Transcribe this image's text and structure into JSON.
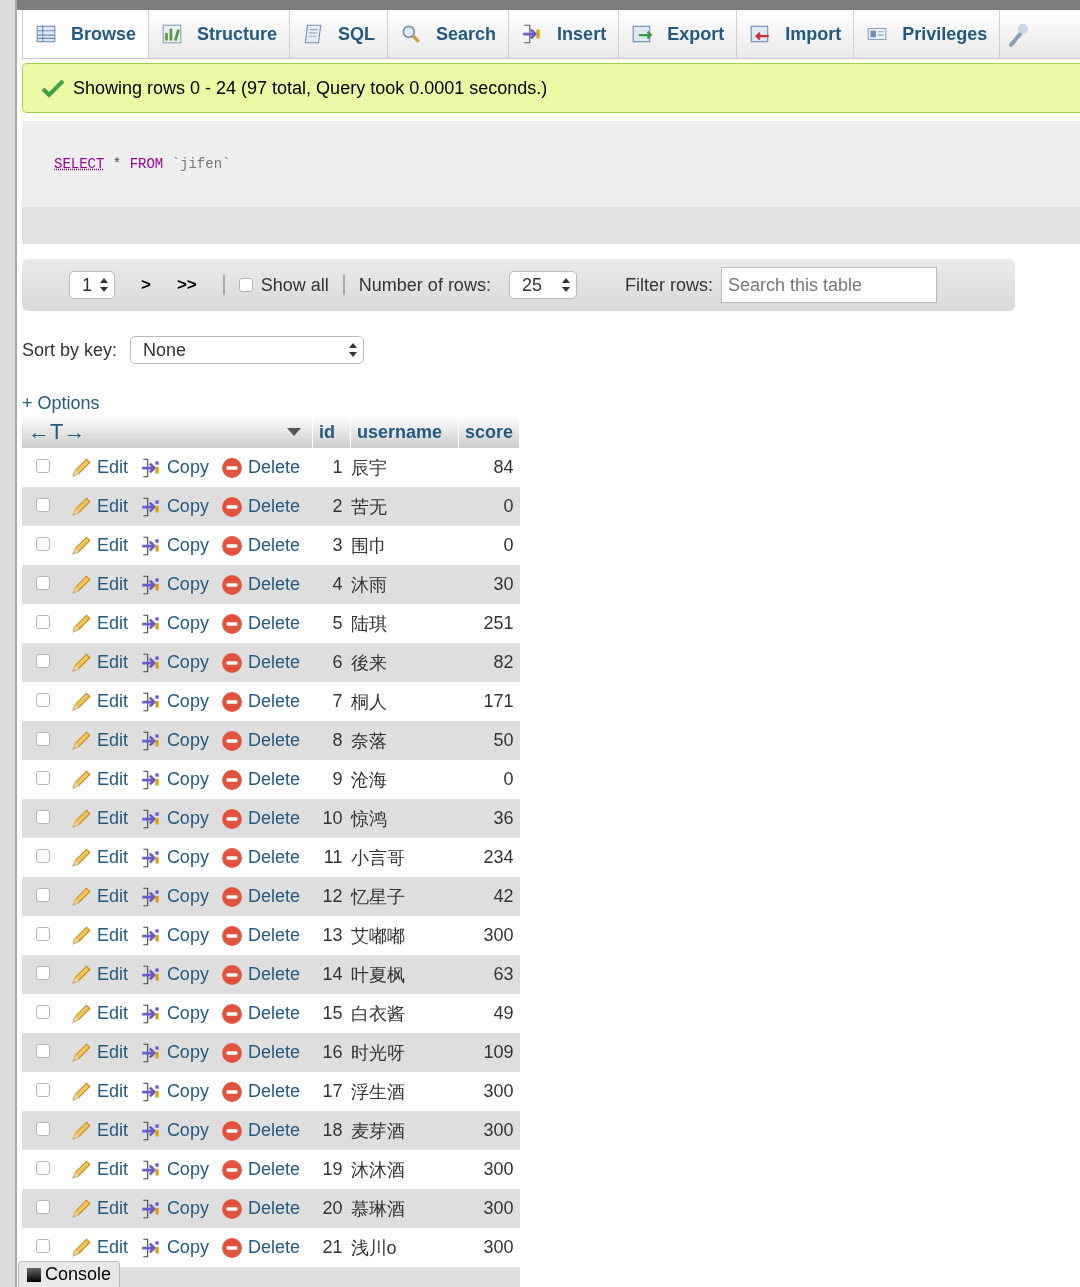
{
  "tabs": [
    {
      "label": "Browse",
      "selected": true
    },
    {
      "label": "Structure",
      "selected": false
    },
    {
      "label": "SQL",
      "selected": false
    },
    {
      "label": "Search",
      "selected": false
    },
    {
      "label": "Insert",
      "selected": false
    },
    {
      "label": "Export",
      "selected": false
    },
    {
      "label": "Import",
      "selected": false
    },
    {
      "label": "Privileges",
      "selected": false
    }
  ],
  "message": "Showing rows 0 - 24 (97 total, Query took 0.0001 seconds.)",
  "sql_query": [
    {
      "text": "SELECT",
      "kind": "keyword_link"
    },
    {
      "text": "*",
      "kind": "operator"
    },
    {
      "text": "FROM",
      "kind": "keyword"
    },
    {
      "text": "`jifen`",
      "kind": "identifier"
    }
  ],
  "navigation": {
    "page": "1",
    "next": ">",
    "last": ">>",
    "show_all": {
      "label": "Show all",
      "checked": false
    },
    "rows_label": "Number of rows:",
    "rows_value": "25",
    "filter_label": "Filter rows:",
    "filter_placeholder": "Search this table"
  },
  "sort": {
    "label": "Sort by key:",
    "value": "None"
  },
  "options_link": "+ Options",
  "table": {
    "resize_handle": "←T→",
    "columns": [
      "id",
      "username",
      "score"
    ],
    "rows": [
      {
        "checked": false,
        "actions": [
          "Edit",
          "Copy",
          "Delete"
        ],
        "id": "1",
        "username": "辰宇",
        "score": "84"
      },
      {
        "checked": false,
        "actions": [
          "Edit",
          "Copy",
          "Delete"
        ],
        "id": "2",
        "username": "苦无",
        "score": "0"
      },
      {
        "checked": false,
        "actions": [
          "Edit",
          "Copy",
          "Delete"
        ],
        "id": "3",
        "username": "围巾",
        "score": "0"
      },
      {
        "checked": false,
        "actions": [
          "Edit",
          "Copy",
          "Delete"
        ],
        "id": "4",
        "username": "沐雨",
        "score": "30"
      },
      {
        "checked": false,
        "actions": [
          "Edit",
          "Copy",
          "Delete"
        ],
        "id": "5",
        "username": "陆琪",
        "score": "251"
      },
      {
        "checked": false,
        "actions": [
          "Edit",
          "Copy",
          "Delete"
        ],
        "id": "6",
        "username": "後来",
        "score": "82"
      },
      {
        "checked": false,
        "actions": [
          "Edit",
          "Copy",
          "Delete"
        ],
        "id": "7",
        "username": "桐人",
        "score": "171"
      },
      {
        "checked": false,
        "actions": [
          "Edit",
          "Copy",
          "Delete"
        ],
        "id": "8",
        "username": "奈落",
        "score": "50"
      },
      {
        "checked": false,
        "actions": [
          "Edit",
          "Copy",
          "Delete"
        ],
        "id": "9",
        "username": "沧海",
        "score": "0"
      },
      {
        "checked": false,
        "actions": [
          "Edit",
          "Copy",
          "Delete"
        ],
        "id": "10",
        "username": "惊鸿",
        "score": "36"
      },
      {
        "checked": false,
        "actions": [
          "Edit",
          "Copy",
          "Delete"
        ],
        "id": "11",
        "username": "小言哥",
        "score": "234"
      },
      {
        "checked": false,
        "actions": [
          "Edit",
          "Copy",
          "Delete"
        ],
        "id": "12",
        "username": "忆星子",
        "score": "42"
      },
      {
        "checked": false,
        "actions": [
          "Edit",
          "Copy",
          "Delete"
        ],
        "id": "13",
        "username": "艾嘟嘟",
        "score": "300"
      },
      {
        "checked": false,
        "actions": [
          "Edit",
          "Copy",
          "Delete"
        ],
        "id": "14",
        "username": "叶夏枫",
        "score": "63"
      },
      {
        "checked": false,
        "actions": [
          "Edit",
          "Copy",
          "Delete"
        ],
        "id": "15",
        "username": "白衣酱",
        "score": "49"
      },
      {
        "checked": false,
        "actions": [
          "Edit",
          "Copy",
          "Delete"
        ],
        "id": "16",
        "username": "时光呀",
        "score": "109"
      },
      {
        "checked": false,
        "actions": [
          "Edit",
          "Copy",
          "Delete"
        ],
        "id": "17",
        "username": "浮生酒",
        "score": "300"
      },
      {
        "checked": false,
        "actions": [
          "Edit",
          "Copy",
          "Delete"
        ],
        "id": "18",
        "username": "麦芽酒",
        "score": "300"
      },
      {
        "checked": false,
        "actions": [
          "Edit",
          "Copy",
          "Delete"
        ],
        "id": "19",
        "username": "沐沐酒",
        "score": "300"
      },
      {
        "checked": false,
        "actions": [
          "Edit",
          "Copy",
          "Delete"
        ],
        "id": "20",
        "username": "慕琳酒",
        "score": "300"
      },
      {
        "checked": false,
        "actions": [
          "Edit",
          "Copy",
          "Delete"
        ],
        "id": "21",
        "username": "浅川o",
        "score": "300"
      }
    ]
  },
  "console": "Console"
}
